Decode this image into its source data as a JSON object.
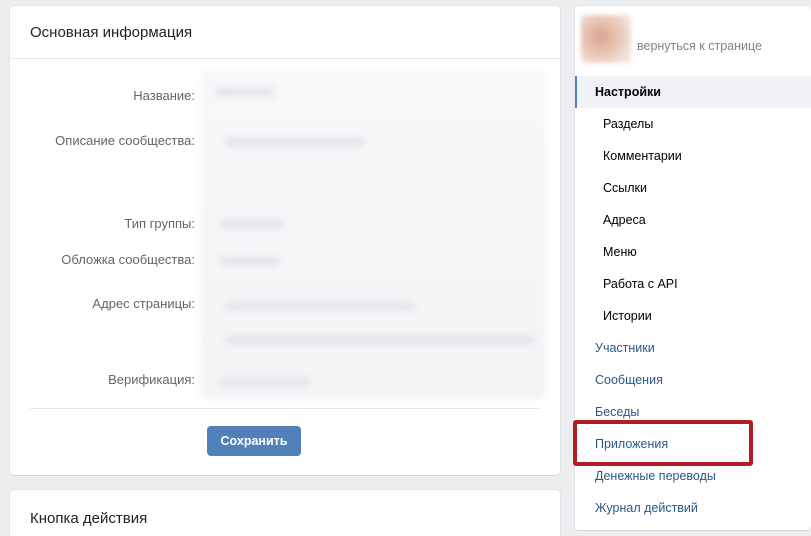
{
  "main_card": {
    "title": "Основная информация",
    "fields": [
      {
        "label": "Название:"
      },
      {
        "label": "Описание сообщества:"
      },
      {
        "label": "Тип группы:"
      },
      {
        "label": "Обложка сообщества:"
      },
      {
        "label": "Адрес страницы:"
      },
      {
        "label": "Верификация:"
      }
    ],
    "save_label": "Сохранить"
  },
  "action_card": {
    "title": "Кнопка действия"
  },
  "side_menu": {
    "back_label": "вернуться к странице",
    "items": [
      {
        "label": "Настройки"
      },
      {
        "label": "Разделы"
      },
      {
        "label": "Комментарии"
      },
      {
        "label": "Ссылки"
      },
      {
        "label": "Адреса"
      },
      {
        "label": "Меню"
      },
      {
        "label": "Работа с API"
      },
      {
        "label": "Истории"
      },
      {
        "label": "Участники"
      },
      {
        "label": "Сообщения"
      },
      {
        "label": "Беседы"
      },
      {
        "label": "Приложения"
      },
      {
        "label": "Денежные переводы"
      },
      {
        "label": "Журнал действий"
      }
    ]
  },
  "colors": {
    "accent": "#5181b8",
    "link": "#2a5885",
    "highlight_frame": "#b01e23",
    "page_bg": "#edeef0"
  }
}
